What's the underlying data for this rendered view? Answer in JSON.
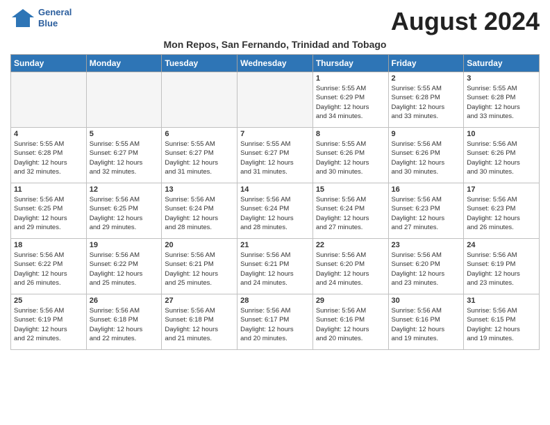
{
  "header": {
    "logo_line1": "General",
    "logo_line2": "Blue",
    "month_title": "August 2024",
    "subtitle": "Mon Repos, San Fernando, Trinidad and Tobago"
  },
  "days_of_week": [
    "Sunday",
    "Monday",
    "Tuesday",
    "Wednesday",
    "Thursday",
    "Friday",
    "Saturday"
  ],
  "weeks": [
    [
      {
        "num": "",
        "info": "",
        "empty": true
      },
      {
        "num": "",
        "info": "",
        "empty": true
      },
      {
        "num": "",
        "info": "",
        "empty": true
      },
      {
        "num": "",
        "info": "",
        "empty": true
      },
      {
        "num": "1",
        "info": "Sunrise: 5:55 AM\nSunset: 6:29 PM\nDaylight: 12 hours\nand 34 minutes.",
        "empty": false
      },
      {
        "num": "2",
        "info": "Sunrise: 5:55 AM\nSunset: 6:28 PM\nDaylight: 12 hours\nand 33 minutes.",
        "empty": false
      },
      {
        "num": "3",
        "info": "Sunrise: 5:55 AM\nSunset: 6:28 PM\nDaylight: 12 hours\nand 33 minutes.",
        "empty": false
      }
    ],
    [
      {
        "num": "4",
        "info": "Sunrise: 5:55 AM\nSunset: 6:28 PM\nDaylight: 12 hours\nand 32 minutes.",
        "empty": false
      },
      {
        "num": "5",
        "info": "Sunrise: 5:55 AM\nSunset: 6:27 PM\nDaylight: 12 hours\nand 32 minutes.",
        "empty": false
      },
      {
        "num": "6",
        "info": "Sunrise: 5:55 AM\nSunset: 6:27 PM\nDaylight: 12 hours\nand 31 minutes.",
        "empty": false
      },
      {
        "num": "7",
        "info": "Sunrise: 5:55 AM\nSunset: 6:27 PM\nDaylight: 12 hours\nand 31 minutes.",
        "empty": false
      },
      {
        "num": "8",
        "info": "Sunrise: 5:55 AM\nSunset: 6:26 PM\nDaylight: 12 hours\nand 30 minutes.",
        "empty": false
      },
      {
        "num": "9",
        "info": "Sunrise: 5:56 AM\nSunset: 6:26 PM\nDaylight: 12 hours\nand 30 minutes.",
        "empty": false
      },
      {
        "num": "10",
        "info": "Sunrise: 5:56 AM\nSunset: 6:26 PM\nDaylight: 12 hours\nand 30 minutes.",
        "empty": false
      }
    ],
    [
      {
        "num": "11",
        "info": "Sunrise: 5:56 AM\nSunset: 6:25 PM\nDaylight: 12 hours\nand 29 minutes.",
        "empty": false
      },
      {
        "num": "12",
        "info": "Sunrise: 5:56 AM\nSunset: 6:25 PM\nDaylight: 12 hours\nand 29 minutes.",
        "empty": false
      },
      {
        "num": "13",
        "info": "Sunrise: 5:56 AM\nSunset: 6:24 PM\nDaylight: 12 hours\nand 28 minutes.",
        "empty": false
      },
      {
        "num": "14",
        "info": "Sunrise: 5:56 AM\nSunset: 6:24 PM\nDaylight: 12 hours\nand 28 minutes.",
        "empty": false
      },
      {
        "num": "15",
        "info": "Sunrise: 5:56 AM\nSunset: 6:24 PM\nDaylight: 12 hours\nand 27 minutes.",
        "empty": false
      },
      {
        "num": "16",
        "info": "Sunrise: 5:56 AM\nSunset: 6:23 PM\nDaylight: 12 hours\nand 27 minutes.",
        "empty": false
      },
      {
        "num": "17",
        "info": "Sunrise: 5:56 AM\nSunset: 6:23 PM\nDaylight: 12 hours\nand 26 minutes.",
        "empty": false
      }
    ],
    [
      {
        "num": "18",
        "info": "Sunrise: 5:56 AM\nSunset: 6:22 PM\nDaylight: 12 hours\nand 26 minutes.",
        "empty": false
      },
      {
        "num": "19",
        "info": "Sunrise: 5:56 AM\nSunset: 6:22 PM\nDaylight: 12 hours\nand 25 minutes.",
        "empty": false
      },
      {
        "num": "20",
        "info": "Sunrise: 5:56 AM\nSunset: 6:21 PM\nDaylight: 12 hours\nand 25 minutes.",
        "empty": false
      },
      {
        "num": "21",
        "info": "Sunrise: 5:56 AM\nSunset: 6:21 PM\nDaylight: 12 hours\nand 24 minutes.",
        "empty": false
      },
      {
        "num": "22",
        "info": "Sunrise: 5:56 AM\nSunset: 6:20 PM\nDaylight: 12 hours\nand 24 minutes.",
        "empty": false
      },
      {
        "num": "23",
        "info": "Sunrise: 5:56 AM\nSunset: 6:20 PM\nDaylight: 12 hours\nand 23 minutes.",
        "empty": false
      },
      {
        "num": "24",
        "info": "Sunrise: 5:56 AM\nSunset: 6:19 PM\nDaylight: 12 hours\nand 23 minutes.",
        "empty": false
      }
    ],
    [
      {
        "num": "25",
        "info": "Sunrise: 5:56 AM\nSunset: 6:19 PM\nDaylight: 12 hours\nand 22 minutes.",
        "empty": false
      },
      {
        "num": "26",
        "info": "Sunrise: 5:56 AM\nSunset: 6:18 PM\nDaylight: 12 hours\nand 22 minutes.",
        "empty": false
      },
      {
        "num": "27",
        "info": "Sunrise: 5:56 AM\nSunset: 6:18 PM\nDaylight: 12 hours\nand 21 minutes.",
        "empty": false
      },
      {
        "num": "28",
        "info": "Sunrise: 5:56 AM\nSunset: 6:17 PM\nDaylight: 12 hours\nand 20 minutes.",
        "empty": false
      },
      {
        "num": "29",
        "info": "Sunrise: 5:56 AM\nSunset: 6:16 PM\nDaylight: 12 hours\nand 20 minutes.",
        "empty": false
      },
      {
        "num": "30",
        "info": "Sunrise: 5:56 AM\nSunset: 6:16 PM\nDaylight: 12 hours\nand 19 minutes.",
        "empty": false
      },
      {
        "num": "31",
        "info": "Sunrise: 5:56 AM\nSunset: 6:15 PM\nDaylight: 12 hours\nand 19 minutes.",
        "empty": false
      }
    ]
  ]
}
